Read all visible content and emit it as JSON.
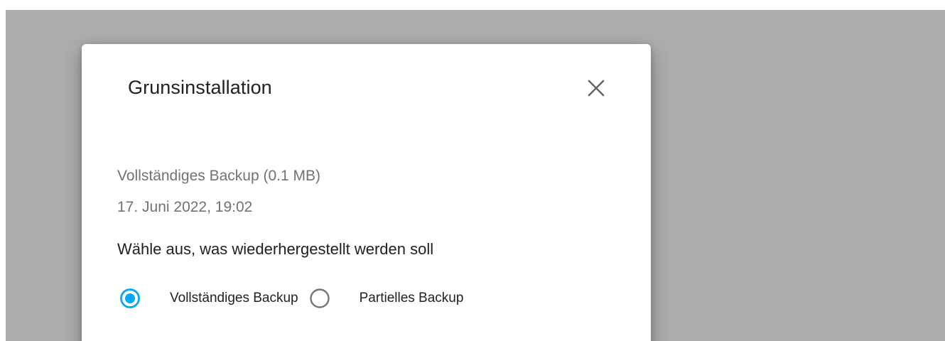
{
  "dialog": {
    "title": "Grunsinstallation",
    "close_icon": "close-icon"
  },
  "backup": {
    "type_and_size": "Vollständiges Backup (0.1 MB)",
    "date": "17. Juni 2022, 19:02"
  },
  "restore": {
    "prompt": "Wähle aus, was wiederhergestellt werden soll",
    "options": [
      {
        "label": "Vollständiges Backup",
        "selected": true
      },
      {
        "label": "Partielles Backup",
        "selected": false
      }
    ]
  },
  "colors": {
    "accent": "#03a9f4",
    "backdrop": "#adadad",
    "radio_unselected": "#757575"
  }
}
